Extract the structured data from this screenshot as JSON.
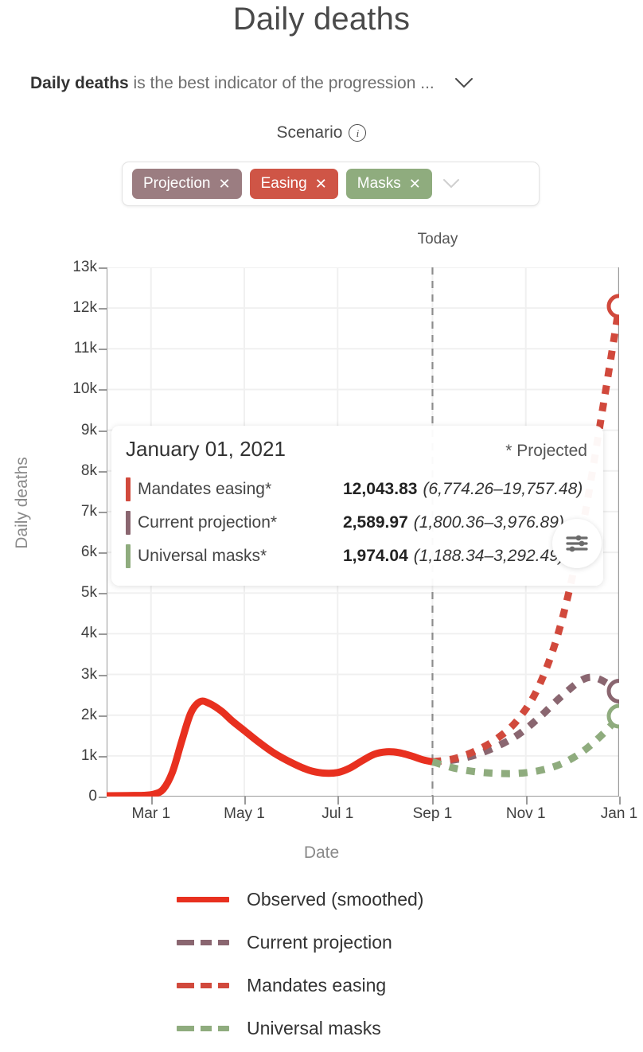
{
  "header": {
    "title": "Daily deaths",
    "subtitle_bold": "Daily deaths",
    "subtitle_rest": " is the best indicator of the progression ...",
    "expand_icon": "chevron-down-icon"
  },
  "scenario": {
    "label": "Scenario",
    "info_icon": "info-icon",
    "caret_icon": "chevron-down-icon",
    "pills": [
      {
        "label": "Projection",
        "remove": "✕",
        "color": "#9b7d81"
      },
      {
        "label": "Easing",
        "remove": "✕",
        "color": "#cf5546"
      },
      {
        "label": "Masks",
        "remove": "✕",
        "color": "#8fac7e"
      }
    ]
  },
  "settings_icon": "sliders-icon",
  "tooltip": {
    "date": "January 01, 2021",
    "projected_note": "* Projected",
    "rows": [
      {
        "color": "#d1493c",
        "name": "Mandates easing*",
        "value": "12,043.83",
        "ci": "(6,774.26–19,757.48)"
      },
      {
        "color": "#8a6670",
        "name": "Current projection*",
        "value": "2,589.97",
        "ci": "(1,800.36–3,976.89)"
      },
      {
        "color": "#8fac7e",
        "name": "Universal masks*",
        "value": "1,974.04",
        "ci": "(1,188.34–3,292.49)"
      }
    ]
  },
  "chart_data": {
    "type": "line",
    "title": "Daily deaths",
    "xlabel": "Date",
    "ylabel": "Daily deaths",
    "ylim": [
      0,
      13000
    ],
    "yticks": [
      "0",
      "1k",
      "2k",
      "3k",
      "4k",
      "5k",
      "6k",
      "7k",
      "8k",
      "9k",
      "10k",
      "11k",
      "12k",
      "13k"
    ],
    "ytick_values": [
      0,
      1000,
      2000,
      3000,
      4000,
      5000,
      6000,
      7000,
      8000,
      9000,
      10000,
      11000,
      12000,
      13000
    ],
    "xticks": [
      "Mar 1",
      "May 1",
      "Jul 1",
      "Sep 1",
      "Nov 1",
      "Jan 1"
    ],
    "xtick_values": [
      60,
      121,
      182,
      244,
      305,
      366
    ],
    "xlim": [
      31,
      366
    ],
    "grid": true,
    "legend_position": "bottom",
    "annotations": [
      {
        "label": "Today",
        "x": 244,
        "style": "dashed-vertical-line"
      }
    ],
    "series": [
      {
        "name": "Observed (smoothed)",
        "color": "#e8301f",
        "style": "solid",
        "x": [
          31,
          45,
          55,
          62,
          68,
          74,
          80,
          86,
          92,
          98,
          106,
          113,
          121,
          130,
          140,
          152,
          163,
          172,
          182,
          190,
          198,
          206,
          214,
          222,
          230,
          238,
          244
        ],
        "values": [
          20,
          25,
          30,
          60,
          180,
          600,
          1350,
          2050,
          2330,
          2290,
          2100,
          1860,
          1620,
          1350,
          1080,
          830,
          650,
          580,
          590,
          700,
          880,
          1040,
          1100,
          1080,
          1000,
          900,
          855
        ]
      },
      {
        "name": "Current projection",
        "color": "#8a6670",
        "style": "dashed",
        "x": [
          244,
          258,
          272,
          286,
          300,
          314,
          328,
          342,
          352,
          366
        ],
        "values": [
          855,
          900,
          1020,
          1230,
          1520,
          1950,
          2450,
          2870,
          2900,
          2590
        ]
      },
      {
        "name": "Mandates easing",
        "color": "#d1493c",
        "style": "dashed",
        "x": [
          244,
          258,
          272,
          286,
          300,
          314,
          328,
          342,
          356,
          366
        ],
        "values": [
          855,
          930,
          1120,
          1420,
          1900,
          2750,
          4250,
          6600,
          9700,
          12044
        ]
      },
      {
        "name": "Universal masks",
        "color": "#8fac7e",
        "style": "dashed",
        "x": [
          244,
          258,
          272,
          286,
          300,
          314,
          328,
          342,
          356,
          366
        ],
        "values": [
          855,
          700,
          610,
          570,
          570,
          640,
          800,
          1100,
          1560,
          1974
        ]
      }
    ],
    "endpoints": [
      {
        "series": "Mandates easing",
        "x": 366,
        "y": 12044,
        "color": "#d1493c"
      },
      {
        "series": "Current projection",
        "x": 366,
        "y": 2590,
        "color": "#8a6670"
      },
      {
        "series": "Universal masks",
        "x": 366,
        "y": 1974,
        "color": "#8fac7e"
      }
    ]
  },
  "legend": [
    {
      "label": "Observed (smoothed)",
      "color": "#e8301f",
      "style": "solid"
    },
    {
      "label": "Current projection",
      "color": "#8a6670",
      "style": "dashed"
    },
    {
      "label": "Mandates easing",
      "color": "#d1493c",
      "style": "dashed"
    },
    {
      "label": "Universal masks",
      "color": "#8fac7e",
      "style": "dashed"
    }
  ]
}
